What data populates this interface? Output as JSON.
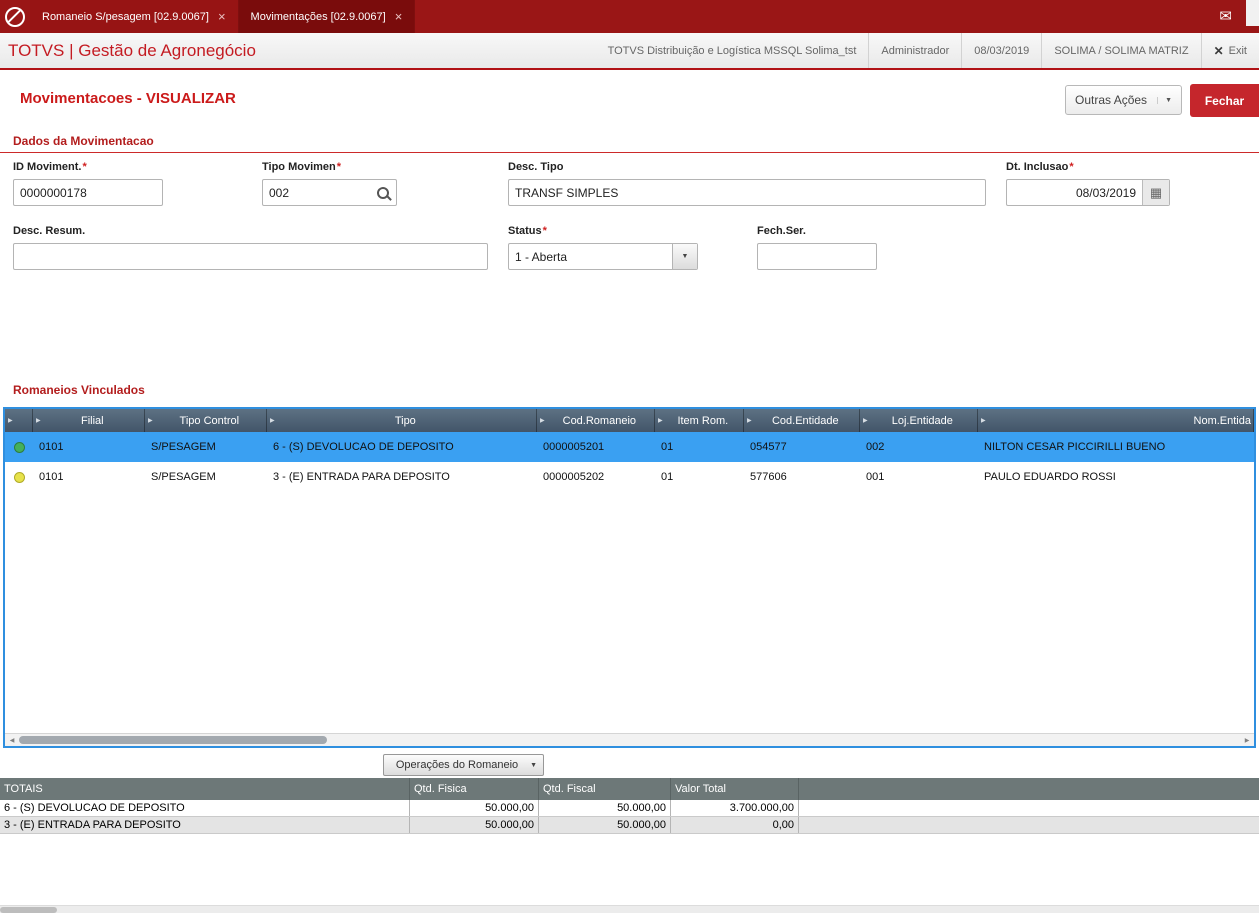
{
  "icons": {
    "close": "×",
    "mail": "✉",
    "exit": "✕",
    "dropdown": "▼",
    "col_arrow": "▶",
    "scroll_left": "◀",
    "scroll_right": "▶",
    "calendar": "▦"
  },
  "ui": {
    "required_mark": "*"
  },
  "colors": {
    "topbar": "#9a1616",
    "active_tab": "#7a0c0c",
    "accent_red": "#c5262c",
    "grid_header": "#46586c",
    "grid_border": "#2f8fdf",
    "selected_row": "#3aa0f2",
    "totals_header": "#6d7878",
    "status_green": "#44b05b",
    "status_yellow": "#e7e24a"
  },
  "topbar": {
    "tabs": [
      {
        "label": "Romaneio S/pesagem [02.9.0067]",
        "active": false
      },
      {
        "label": "Movimentações [02.9.0067]",
        "active": true
      }
    ]
  },
  "header": {
    "app_title": "TOTVS | Gestão de Agronegócio",
    "environment": "TOTVS Distribuição e Logística MSSQL Solima_tst",
    "user": "Administrador",
    "date": "08/03/2019",
    "company": "SOLIMA / SOLIMA MATRIZ",
    "exit_label": "Exit"
  },
  "page": {
    "title": "Movimentacoes - VISUALIZAR",
    "other_actions": "Outras Ações",
    "close": "Fechar"
  },
  "form": {
    "section_title": "Dados da Movimentacao",
    "fields": {
      "id_moviment": {
        "label": "ID Moviment.",
        "required": true,
        "value": "0000000178"
      },
      "tipo_movimen": {
        "label": "Tipo Movimen",
        "required": true,
        "value": "002"
      },
      "desc_tipo": {
        "label": "Desc. Tipo",
        "required": false,
        "value": "TRANSF SIMPLES"
      },
      "dt_inclusao": {
        "label": "Dt. Inclusao",
        "required": true,
        "value": "08/03/2019"
      },
      "desc_resum": {
        "label": "Desc. Resum.",
        "required": false,
        "value": ""
      },
      "status": {
        "label": "Status",
        "required": true,
        "value": "1 - Aberta"
      },
      "fech_ser": {
        "label": "Fech.Ser.",
        "required": false,
        "value": ""
      }
    }
  },
  "grid": {
    "section_title": "Romaneios Vinculados",
    "columns": [
      "Filial",
      "Tipo Control",
      "Tipo",
      "Cod.Romaneio",
      "Item Rom.",
      "Cod.Entidade",
      "Loj.Entidade",
      "Nom.Entida"
    ],
    "rows": [
      {
        "status": "green",
        "selected": true,
        "cells": [
          "0101",
          "S/PESAGEM",
          "6 - (S) DEVOLUCAO DE DEPOSITO",
          "0000005201",
          "01",
          "054577",
          "002",
          "NILTON CESAR PICCIRILLI BUENO"
        ]
      },
      {
        "status": "yellow",
        "selected": false,
        "cells": [
          "0101",
          "S/PESAGEM",
          "3 - (E) ENTRADA PARA DEPOSITO",
          "0000005202",
          "01",
          "577606",
          "001",
          "PAULO EDUARDO ROSSI"
        ]
      }
    ],
    "operations_button": "Operações do Romaneio"
  },
  "totals": {
    "columns": [
      "TOTAIS",
      "Qtd. Fisica",
      "Qtd. Fiscal",
      "Valor Total"
    ],
    "rows": [
      {
        "label": "6 - (S) DEVOLUCAO DE DEPOSITO",
        "qtd_fisica": "50.000,00",
        "qtd_fiscal": "50.000,00",
        "valor_total": "3.700.000,00"
      },
      {
        "label": "3 - (E) ENTRADA PARA DEPOSITO",
        "qtd_fisica": "50.000,00",
        "qtd_fiscal": "50.000,00",
        "valor_total": "0,00"
      }
    ]
  }
}
